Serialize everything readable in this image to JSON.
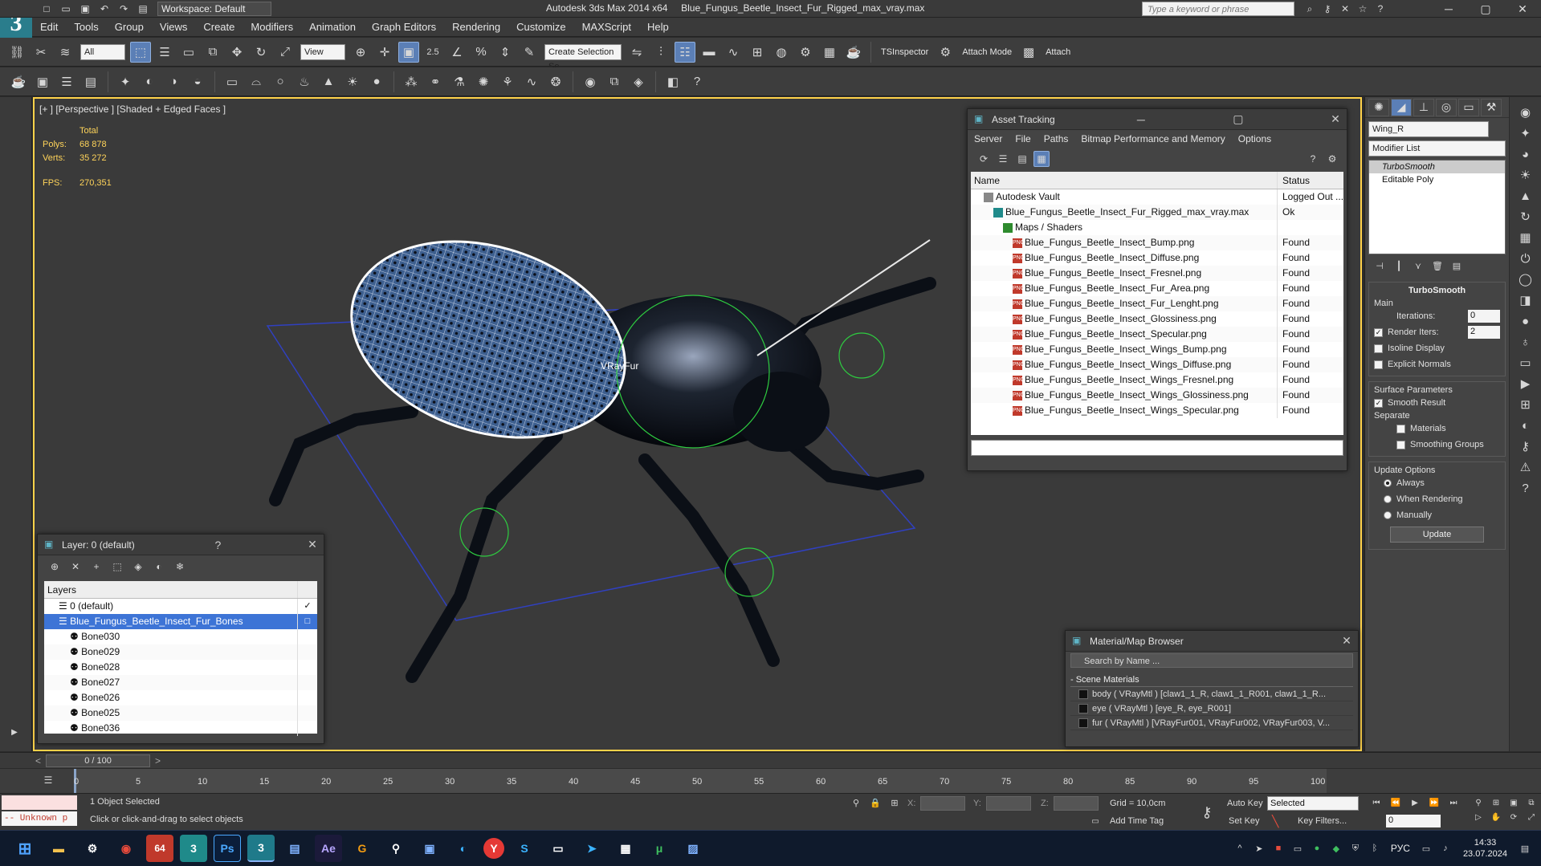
{
  "app": {
    "title": "Autodesk 3ds Max  2014 x64",
    "file": "Blue_Fungus_Beetle_Insect_Fur_Rigged_max_vray.max",
    "workspace": "Workspace: Default",
    "search_placeholder": "Type a keyword or phrase"
  },
  "menu": [
    "Edit",
    "Tools",
    "Group",
    "Views",
    "Create",
    "Modifiers",
    "Animation",
    "Graph Editors",
    "Rendering",
    "Customize",
    "MAXScript",
    "Help"
  ],
  "toolbar": {
    "filter": "All",
    "view": "View",
    "value": "2.5",
    "selection_set": "Create Selection Se",
    "tsinspector": "TSInspector",
    "attach_mode": "Attach Mode",
    "attach": "Attach"
  },
  "viewport": {
    "label": "[+ ] [Perspective ] [Shaded + Edged Faces ]",
    "stats_total": "Total",
    "polys_label": "Polys:",
    "polys": "68 878",
    "verts_label": "Verts:",
    "verts": "35 272",
    "fps_label": "FPS:",
    "fps": "270,351",
    "fur_label": "VRayFur"
  },
  "asset_tracking": {
    "title": "Asset Tracking",
    "menu": [
      "Server",
      "File",
      "Paths",
      "Bitmap Performance and Memory",
      "Options"
    ],
    "col_name": "Name",
    "col_status": "Status",
    "rows": [
      {
        "name": "Autodesk Vault",
        "status": "Logged Out ...",
        "indent": 1
      },
      {
        "name": "Blue_Fungus_Beetle_Insect_Fur_Rigged_max_vray.max",
        "status": "Ok",
        "indent": 2
      },
      {
        "name": "Maps / Shaders",
        "status": "",
        "indent": 3
      },
      {
        "name": "Blue_Fungus_Beetle_Insect_Bump.png",
        "status": "Found",
        "indent": 4
      },
      {
        "name": "Blue_Fungus_Beetle_Insect_Diffuse.png",
        "status": "Found",
        "indent": 4
      },
      {
        "name": "Blue_Fungus_Beetle_Insect_Fresnel.png",
        "status": "Found",
        "indent": 4
      },
      {
        "name": "Blue_Fungus_Beetle_Insect_Fur_Area.png",
        "status": "Found",
        "indent": 4
      },
      {
        "name": "Blue_Fungus_Beetle_Insect_Fur_Lenght.png",
        "status": "Found",
        "indent": 4
      },
      {
        "name": "Blue_Fungus_Beetle_Insect_Glossiness.png",
        "status": "Found",
        "indent": 4
      },
      {
        "name": "Blue_Fungus_Beetle_Insect_Specular.png",
        "status": "Found",
        "indent": 4
      },
      {
        "name": "Blue_Fungus_Beetle_Insect_Wings_Bump.png",
        "status": "Found",
        "indent": 4
      },
      {
        "name": "Blue_Fungus_Beetle_Insect_Wings_Diffuse.png",
        "status": "Found",
        "indent": 4
      },
      {
        "name": "Blue_Fungus_Beetle_Insect_Wings_Fresnel.png",
        "status": "Found",
        "indent": 4
      },
      {
        "name": "Blue_Fungus_Beetle_Insect_Wings_Glossiness.png",
        "status": "Found",
        "indent": 4
      },
      {
        "name": "Blue_Fungus_Beetle_Insect_Wings_Specular.png",
        "status": "Found",
        "indent": 4
      }
    ]
  },
  "layer_panel": {
    "title": "Layer: 0 (default)",
    "help": "?",
    "col": "Layers",
    "rows": [
      {
        "name": "0 (default)",
        "indent": 1,
        "selected": false
      },
      {
        "name": "Blue_Fungus_Beetle_Insect_Fur_Bones",
        "indent": 1,
        "selected": true
      },
      {
        "name": "Bone030",
        "indent": 2,
        "selected": false
      },
      {
        "name": "Bone029",
        "indent": 2,
        "selected": false
      },
      {
        "name": "Bone028",
        "indent": 2,
        "selected": false
      },
      {
        "name": "Bone027",
        "indent": 2,
        "selected": false
      },
      {
        "name": "Bone026",
        "indent": 2,
        "selected": false
      },
      {
        "name": "Bone025",
        "indent": 2,
        "selected": false
      },
      {
        "name": "Bone036",
        "indent": 2,
        "selected": false
      }
    ]
  },
  "material_browser": {
    "title": "Material/Map Browser",
    "search": "Search by Name ...",
    "group": "- Scene Materials",
    "items": [
      "body ( VRayMtl ) [claw1_1_R, claw1_1_R001, claw1_1_R...",
      "eye ( VRayMtl ) [eye_R, eye_R001]",
      "fur ( VRayMtl ) [VRayFur001, VRayFur002, VRayFur003, V..."
    ]
  },
  "modify_panel": {
    "object_name": "Wing_R",
    "modifier_list": "Modifier List",
    "stack": [
      "TurboSmooth",
      "Editable Poly"
    ],
    "rollout_title": "TurboSmooth",
    "main": "Main",
    "iterations_label": "Iterations:",
    "iterations": "0",
    "render_iters_label": "Render Iters:",
    "render_iters": "2",
    "isoline": "Isoline Display",
    "explicit": "Explicit Normals",
    "surface_params": "Surface Parameters",
    "smooth_result": "Smooth Result",
    "separate": "Separate",
    "materials": "Materials",
    "smoothing_groups": "Smoothing Groups",
    "update_options": "Update Options",
    "always": "Always",
    "when_rendering": "When Rendering",
    "manually": "Manually",
    "update": "Update"
  },
  "timeline": {
    "frame": "0 / 100",
    "ticks": [
      "0",
      "5",
      "10",
      "15",
      "20",
      "25",
      "30",
      "35",
      "40",
      "45",
      "50",
      "55",
      "60",
      "65",
      "70",
      "75",
      "80",
      "85",
      "90",
      "95",
      "100"
    ]
  },
  "status": {
    "maxscript": "-- Unknown p",
    "selected": "1 Object Selected",
    "prompt": "Click or click-and-drag to select objects",
    "x_label": "X:",
    "y_label": "Y:",
    "z_label": "Z:",
    "grid": "Grid = 10,0cm",
    "add_time_tag": "Add Time Tag",
    "auto_key": "Auto Key",
    "selected_set": "Selected",
    "set_key": "Set Key",
    "key_filters": "Key Filters...",
    "frame_value": "0"
  },
  "taskbar": {
    "lang": "РУС",
    "time": "14:33",
    "date": "23.07.2024",
    "badge": "64"
  }
}
